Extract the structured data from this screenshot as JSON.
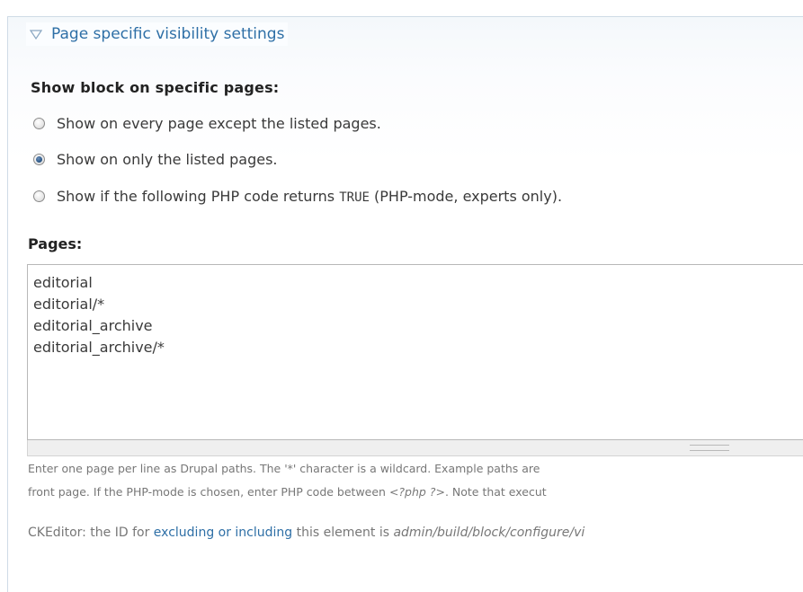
{
  "fieldset": {
    "legend": "Page specific visibility settings",
    "legend_icon": "triangle-down-icon"
  },
  "visibility": {
    "label": "Show block on specific pages:",
    "options": [
      {
        "label": "Show on every page except the listed pages.",
        "checked": false
      },
      {
        "label": "Show on only the listed pages.",
        "checked": true
      },
      {
        "label_prefix": "Show if the following PHP code returns ",
        "code": "TRUE",
        "label_suffix": " (PHP-mode, experts only).",
        "checked": false
      }
    ]
  },
  "pages": {
    "label": "Pages:",
    "lines": [
      "editorial",
      "editorial/*",
      "editorial_archive",
      "editorial_archive/*"
    ]
  },
  "description": {
    "line1": "Enter one page per line as Drupal paths. The '*' character is a wildcard. Example paths are",
    "line2_prefix": "front page. If the PHP-mode is chosen, enter PHP code between ",
    "line2_code": "<?php ?>",
    "line2_suffix": ". Note that execut"
  },
  "ckeditor": {
    "prefix": "CKEditor: the ID for ",
    "link": "excluding or including",
    "middle": " this element is ",
    "path": "admin/build/block/configure/vi"
  },
  "colors": {
    "link": "#2e6fa6",
    "legend_border": "#cfdbe6",
    "radio_checked": "#2f5a8a"
  }
}
